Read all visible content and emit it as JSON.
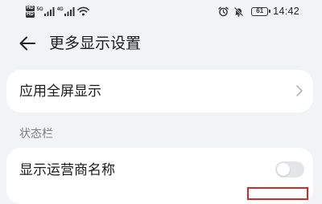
{
  "status_bar": {
    "sim1_badge": "HD",
    "sim2_badge": "HD",
    "sim1_network": "5G",
    "sim2_network": "4G",
    "battery_level": "61",
    "time": "14:42"
  },
  "header": {
    "title": "更多显示设置"
  },
  "fullscreen_item": {
    "label": "应用全屏显示"
  },
  "status_bar_section": {
    "title": "状态栏",
    "show_carrier_name": {
      "label": "显示运营商名称",
      "enabled": false
    }
  },
  "colors": {
    "background": "#f1f3f5",
    "card": "#ffffff",
    "highlight": "#d42a2a",
    "toggle_off": "#e3e5e8"
  }
}
